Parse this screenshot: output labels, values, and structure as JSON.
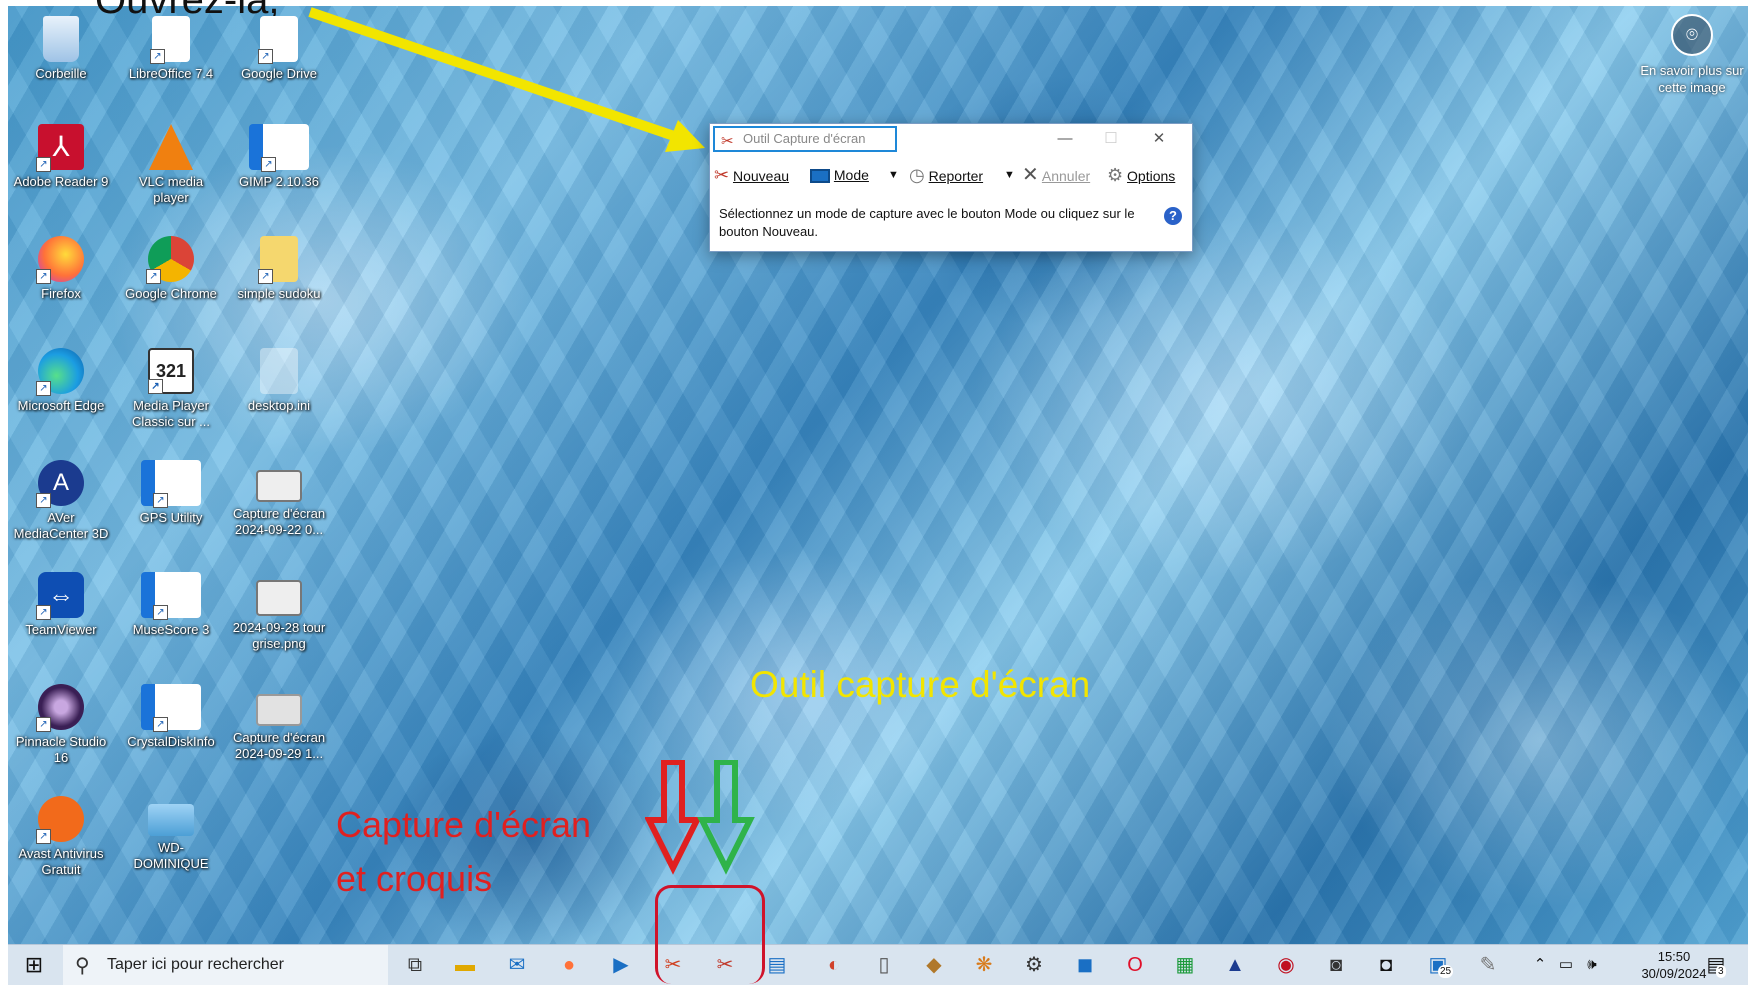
{
  "annotations": {
    "top_text": "Ouvrez-la,",
    "snipping_tool_label": "Outil capture d'écran",
    "snip_sketch_label_line1": "Capture d'écran",
    "snip_sketch_label_line2": "et croquis",
    "colors": {
      "yellow": "#f2e500",
      "red": "#e02020",
      "green": "#2fb34a"
    }
  },
  "desktop": {
    "icons": [
      {
        "label": "Corbeille",
        "icon": "recycle-bin-icon"
      },
      {
        "label": "LibreOffice 7.4",
        "icon": "document-icon"
      },
      {
        "label": "Google Drive",
        "icon": "document-icon"
      },
      {
        "label": "Adobe Reader 9",
        "icon": "adobe-reader-icon"
      },
      {
        "label": "VLC media player",
        "icon": "vlc-icon"
      },
      {
        "label": "GIMP 2.10.36",
        "icon": "app-window-icon"
      },
      {
        "label": "Firefox",
        "icon": "firefox-icon"
      },
      {
        "label": "Google Chrome",
        "icon": "chrome-icon"
      },
      {
        "label": "simple sudoku",
        "icon": "folder-icon"
      },
      {
        "label": "Microsoft Edge",
        "icon": "edge-icon"
      },
      {
        "label": "Media Player Classic sur ...",
        "icon": "mpc-icon"
      },
      {
        "label": "desktop.ini",
        "icon": "file-icon"
      },
      {
        "label": "AVer MediaCenter 3D",
        "icon": "aver-icon"
      },
      {
        "label": "GPS Utility",
        "icon": "app-window-icon"
      },
      {
        "label": "Capture d'écran 2024-09-22 0...",
        "icon": "image-file-icon"
      },
      {
        "label": "TeamViewer",
        "icon": "teamviewer-icon"
      },
      {
        "label": "MuseScore 3",
        "icon": "app-window-icon"
      },
      {
        "label": "2024-09-28 tour grise.png",
        "icon": "image-file-icon"
      },
      {
        "label": "Pinnacle Studio 16",
        "icon": "pinnacle-icon"
      },
      {
        "label": "CrystalDiskInfo",
        "icon": "app-window-icon"
      },
      {
        "label": "Capture d'écran 2024-09-29 1...",
        "icon": "image-file-icon"
      },
      {
        "label": "Avast Antivirus Gratuit",
        "icon": "avast-icon"
      },
      {
        "label": "WD-DOMINIQUE",
        "icon": "computer-icon"
      }
    ],
    "learn_more": "En savoir plus sur cette image"
  },
  "snipping_tool": {
    "title": "Outil Capture d'écran",
    "toolbar": {
      "new": "Nouveau",
      "mode": "Mode",
      "delay": "Reporter",
      "cancel": "Annuler",
      "options": "Options"
    },
    "message": "Sélectionnez un mode de capture avec le bouton Mode ou cliquez sur le bouton Nouveau."
  },
  "taskbar": {
    "search_placeholder": "Taper ici pour rechercher",
    "time": "15:50",
    "date": "30/09/2024",
    "badge_count": "25",
    "notification_count": "3"
  }
}
